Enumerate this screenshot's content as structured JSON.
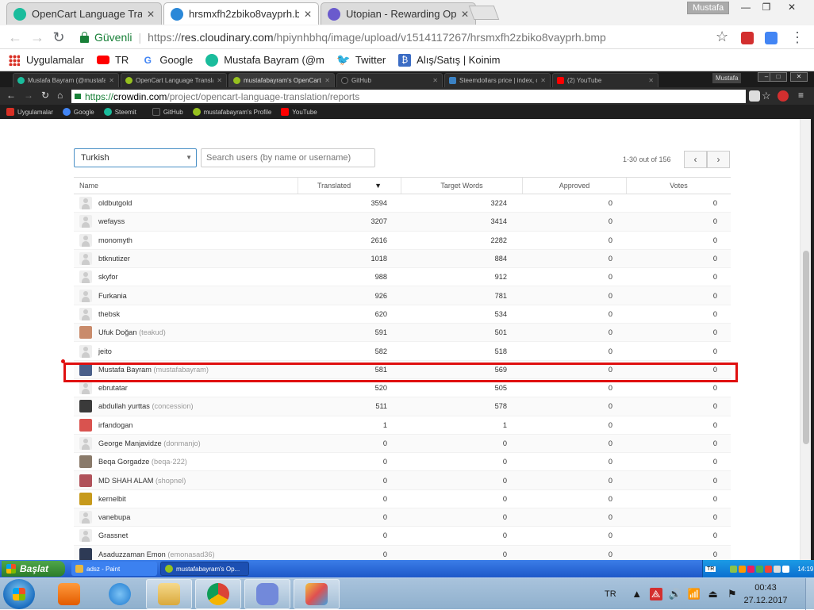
{
  "outer_browser": {
    "tabs": [
      {
        "title": "OpenCart Language Tran",
        "fav_color": "#1abc9c",
        "active": false
      },
      {
        "title": "hrsmxfh2zbiko8vayprh.b",
        "fav_color": "#2b88d8",
        "active": true
      },
      {
        "title": "Utopian - Rewarding Op",
        "fav_color": "#6a5acd",
        "active": false
      }
    ],
    "user": "Mustafa",
    "window_controls": [
      "—",
      "❐",
      "✕"
    ],
    "secure_label": "Güvenli",
    "url_prefix": "https://",
    "url_host": "res.cloudinary.com",
    "url_path": "/hpiynhbhq/image/upload/v1514117267/hrsmxfh2zbiko8vayprh.bmp",
    "bookmarks": [
      {
        "label": "Uygulamalar",
        "icon": "apps-grid-icon"
      },
      {
        "label": "TR",
        "icon": "youtube-icon"
      },
      {
        "label": "Google",
        "icon": "google-icon"
      },
      {
        "label": "Mustafa Bayram (@m",
        "icon": "steemit-icon"
      },
      {
        "label": "Twitter",
        "icon": "twitter-icon"
      },
      {
        "label": "Alış/Satış | Koinim",
        "icon": "bitcoin-icon"
      }
    ]
  },
  "inner_browser": {
    "tabs": [
      {
        "title": "Mustafa Bayram (@mustafab",
        "fav_color": "#1abc9c",
        "active": false
      },
      {
        "title": "OpenCart Language Translat",
        "fav_color": "#96c11f",
        "active": false
      },
      {
        "title": "mustafabayram's OpenCart L",
        "fav_color": "#96c11f",
        "active": true
      },
      {
        "title": "GitHub",
        "fav_color": "#222222",
        "active": false
      },
      {
        "title": "Steemdollars price | index, c",
        "fav_color": "#3b82c4",
        "active": false
      },
      {
        "title": "(2) YouTube",
        "fav_color": "#ff0000",
        "active": false
      }
    ],
    "user": "Mustafa",
    "url_prefix": "https://",
    "url_host": "crowdin.com",
    "url_path": "/project/opencart-language-translation/reports",
    "bookmarks": [
      {
        "label": "Uygulamalar",
        "color": "#d93025"
      },
      {
        "label": "Google",
        "color": "#4285f4"
      },
      {
        "label": "Steemit",
        "color": "#1abc9c"
      },
      {
        "label": "GitHub",
        "color": "#222222"
      },
      {
        "label": "mustafabayram's Profile",
        "color": "#96c11f"
      },
      {
        "label": "YouTube",
        "color": "#ff0000"
      }
    ]
  },
  "report": {
    "language": "Turkish",
    "search_placeholder": "Search users (by name or username)",
    "pager_text": "1-30 out of 156",
    "columns": {
      "name": "Name",
      "translated": "Translated",
      "target_words": "Target Words",
      "approved": "Approved",
      "votes": "Votes"
    },
    "rows": [
      {
        "name": "oldbutgold",
        "handle": "",
        "translated": "3594",
        "target": "3224",
        "approved": "0",
        "votes": "0",
        "avatar": "default"
      },
      {
        "name": "wefayss",
        "handle": "",
        "translated": "3207",
        "target": "3414",
        "approved": "0",
        "votes": "0",
        "avatar": "default"
      },
      {
        "name": "monomyth",
        "handle": "",
        "translated": "2616",
        "target": "2282",
        "approved": "0",
        "votes": "0",
        "avatar": "default"
      },
      {
        "name": "btknutizer",
        "handle": "",
        "translated": "1018",
        "target": "884",
        "approved": "0",
        "votes": "0",
        "avatar": "default"
      },
      {
        "name": "skyfor",
        "handle": "",
        "translated": "988",
        "target": "912",
        "approved": "0",
        "votes": "0",
        "avatar": "default"
      },
      {
        "name": "Furkania",
        "handle": "",
        "translated": "926",
        "target": "781",
        "approved": "0",
        "votes": "0",
        "avatar": "default"
      },
      {
        "name": "thebsk",
        "handle": "",
        "translated": "620",
        "target": "534",
        "approved": "0",
        "votes": "0",
        "avatar": "default"
      },
      {
        "name": "Ufuk Doğan",
        "handle": "(teakud)",
        "translated": "591",
        "target": "501",
        "approved": "0",
        "votes": "0",
        "avatar": "#c98b6b"
      },
      {
        "name": "jeito",
        "handle": "",
        "translated": "582",
        "target": "518",
        "approved": "0",
        "votes": "0",
        "avatar": "default"
      },
      {
        "name": "Mustafa Bayram",
        "handle": "(mustafabayram)",
        "translated": "581",
        "target": "569",
        "approved": "0",
        "votes": "0",
        "avatar": "#4a5f8a"
      },
      {
        "name": "ebrutatar",
        "handle": "",
        "translated": "520",
        "target": "505",
        "approved": "0",
        "votes": "0",
        "avatar": "default"
      },
      {
        "name": "abdullah yurttas",
        "handle": "(concession)",
        "translated": "511",
        "target": "578",
        "approved": "0",
        "votes": "0",
        "avatar": "#3a3a3a"
      },
      {
        "name": "irfandogan",
        "handle": "",
        "translated": "1",
        "target": "1",
        "approved": "0",
        "votes": "0",
        "avatar": "#d9534f"
      },
      {
        "name": "George Manjavidze",
        "handle": "(donmanjo)",
        "translated": "0",
        "target": "0",
        "approved": "0",
        "votes": "0",
        "avatar": "default"
      },
      {
        "name": "Beqa Gorgadze",
        "handle": "(beqa-222)",
        "translated": "0",
        "target": "0",
        "approved": "0",
        "votes": "0",
        "avatar": "#8a7a6a"
      },
      {
        "name": "MD SHAH ALAM",
        "handle": "(shopnel)",
        "translated": "0",
        "target": "0",
        "approved": "0",
        "votes": "0",
        "avatar": "#b0525a"
      },
      {
        "name": "kernelbit",
        "handle": "",
        "translated": "0",
        "target": "0",
        "approved": "0",
        "votes": "0",
        "avatar": "#c79a1c"
      },
      {
        "name": "vanebupa",
        "handle": "",
        "translated": "0",
        "target": "0",
        "approved": "0",
        "votes": "0",
        "avatar": "default"
      },
      {
        "name": "Grassnet",
        "handle": "",
        "translated": "0",
        "target": "0",
        "approved": "0",
        "votes": "0",
        "avatar": "default"
      },
      {
        "name": "Asaduzzaman Emon",
        "handle": "(emonasad36)",
        "translated": "0",
        "target": "0",
        "approved": "0",
        "votes": "0",
        "avatar": "#2d3a55"
      }
    ]
  },
  "xp_taskbar": {
    "start_label": "Başlat",
    "tasks": [
      {
        "label": "adsz - Paint",
        "color": "#e8b840"
      },
      {
        "label": "mustafabayram's Op...",
        "color": "#96c11f"
      }
    ],
    "lang": "TR",
    "time": "14:19"
  },
  "w7_taskbar": {
    "lang": "TR",
    "time": "00:43",
    "date": "27.12.2017"
  }
}
